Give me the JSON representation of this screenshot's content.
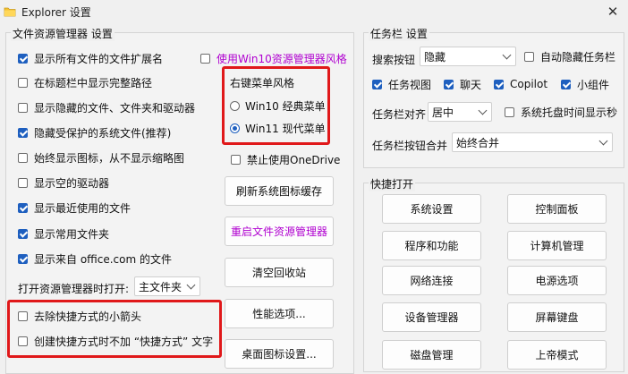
{
  "window": {
    "title": "Explorer 设置",
    "close_icon": "close-icon",
    "app_icon": "folder-icon"
  },
  "file_explorer": {
    "title": "文件资源管理器 设置",
    "options": [
      {
        "label": "显示所有文件的文件扩展名",
        "checked": true
      },
      {
        "label": "在标题栏中显示完整路径",
        "checked": false
      },
      {
        "label": "显示隐藏的文件、文件夹和驱动器",
        "checked": false
      },
      {
        "label": "隐藏受保护的系统文件(推荐)",
        "checked": true
      },
      {
        "label": "始终显示图标，从不显示缩略图",
        "checked": false
      },
      {
        "label": "显示空的驱动器",
        "checked": false
      },
      {
        "label": "显示最近使用的文件",
        "checked": true
      },
      {
        "label": "显示常用文件夹",
        "checked": true
      },
      {
        "label": "显示来自 office.com 的文件",
        "checked": true
      }
    ],
    "open_to_label": "打开资源管理器时打开:",
    "open_to_value": "主文件夹",
    "shortcut_options": [
      {
        "label": "去除快捷方式的小箭头",
        "checked": false
      },
      {
        "label": "创建快捷方式时不加 “快捷方式” 文字",
        "checked": false
      }
    ],
    "win10_explorer": {
      "label": "使用Win10资源管理器风格",
      "checked": false
    },
    "context_menu": {
      "title": "右键菜单风格",
      "options": [
        {
          "label": "Win10 经典菜单",
          "checked": false
        },
        {
          "label": "Win11 现代菜单",
          "checked": true
        }
      ]
    },
    "disable_onedrive": {
      "label": "禁止使用OneDrive",
      "checked": false
    },
    "buttons": [
      {
        "label": "刷新系统图标缓存"
      },
      {
        "label": "重启文件资源管理器"
      },
      {
        "label": "清空回收站"
      },
      {
        "label": "性能选项..."
      },
      {
        "label": "桌面图标设置..."
      }
    ]
  },
  "taskbar": {
    "title": "任务栏 设置",
    "search_label": "搜索按钮",
    "search_value": "隐藏",
    "auto_hide": {
      "label": "自动隐藏任务栏",
      "checked": false
    },
    "items": [
      {
        "label": "任务视图",
        "checked": true
      },
      {
        "label": "聊天",
        "checked": true
      },
      {
        "label": "Copilot",
        "checked": true
      },
      {
        "label": "小组件",
        "checked": true
      }
    ],
    "align_label": "任务栏对齐",
    "align_value": "居中",
    "seconds": {
      "label": "系统托盘时间显示秒",
      "checked": false
    },
    "combine_label": "任务栏按钮合并",
    "combine_value": "始终合并"
  },
  "quick_open": {
    "title": "快捷打开",
    "buttons": [
      {
        "label": "系统设置"
      },
      {
        "label": "控制面板"
      },
      {
        "label": "程序和功能"
      },
      {
        "label": "计算机管理"
      },
      {
        "label": "网络连接"
      },
      {
        "label": "电源选项"
      },
      {
        "label": "设备管理器"
      },
      {
        "label": "屏幕键盘"
      },
      {
        "label": "磁盘管理"
      },
      {
        "label": "上帝模式"
      }
    ]
  },
  "colors": {
    "accent": "#1e5fbf",
    "highlight": "#e0181a",
    "link": "#b000d0"
  }
}
